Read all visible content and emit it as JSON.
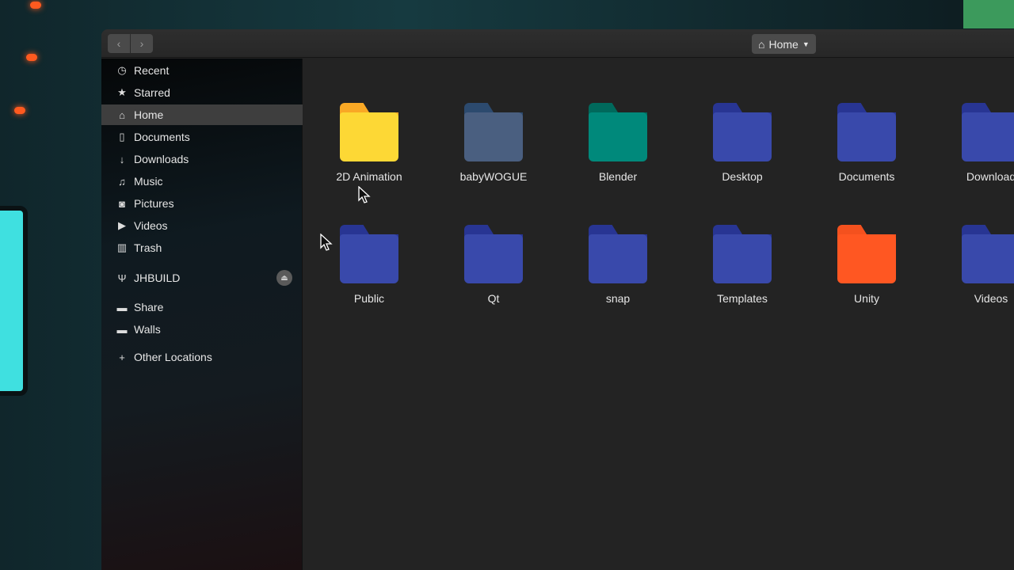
{
  "header": {
    "back_icon": "chevron-left-icon",
    "forward_icon": "chevron-right-icon",
    "location": "Home",
    "location_icon": "home-icon"
  },
  "sidebar": {
    "items": [
      {
        "label": "Recent",
        "icon": "clock-icon",
        "glyph": "◷"
      },
      {
        "label": "Starred",
        "icon": "star-icon",
        "glyph": "★"
      },
      {
        "label": "Home",
        "icon": "home-icon",
        "glyph": "⌂",
        "selected": true
      },
      {
        "label": "Documents",
        "icon": "document-icon",
        "glyph": "▯"
      },
      {
        "label": "Downloads",
        "icon": "download-icon",
        "glyph": "↓"
      },
      {
        "label": "Music",
        "icon": "music-icon",
        "glyph": "♫"
      },
      {
        "label": "Pictures",
        "icon": "camera-icon",
        "glyph": "◙"
      },
      {
        "label": "Videos",
        "icon": "video-icon",
        "glyph": "▶"
      },
      {
        "label": "Trash",
        "icon": "trash-icon",
        "glyph": "▥"
      },
      {
        "label": "JHBUILD",
        "icon": "usb-icon",
        "glyph": "Ψ",
        "eject": true
      },
      {
        "label": "Share",
        "icon": "folder-icon",
        "glyph": "▬"
      },
      {
        "label": "Walls",
        "icon": "folder-icon",
        "glyph": "▬"
      },
      {
        "label": "Other Locations",
        "icon": "plus-icon",
        "glyph": "+"
      }
    ]
  },
  "files": [
    {
      "name": "2D Animation",
      "color": "#fdd835",
      "tab": "#f9a825"
    },
    {
      "name": "babyWOGUE",
      "color": "#4a5f80",
      "tab": "#2c4a6e"
    },
    {
      "name": "Blender",
      "color": "#00897b",
      "tab": "#00695c"
    },
    {
      "name": "Desktop",
      "color": "#3949ab",
      "tab": "#283593"
    },
    {
      "name": "Documents",
      "color": "#3949ab",
      "tab": "#283593"
    },
    {
      "name": "Download",
      "color": "#3949ab",
      "tab": "#283593"
    },
    {
      "name": "Public",
      "color": "#3949ab",
      "tab": "#283593"
    },
    {
      "name": "Qt",
      "color": "#3949ab",
      "tab": "#283593"
    },
    {
      "name": "snap",
      "color": "#3949ab",
      "tab": "#283593"
    },
    {
      "name": "Templates",
      "color": "#3949ab",
      "tab": "#283593"
    },
    {
      "name": "Unity",
      "color": "#ff5722",
      "tab": "#f4511e"
    },
    {
      "name": "Videos",
      "color": "#3949ab",
      "tab": "#283593"
    }
  ]
}
